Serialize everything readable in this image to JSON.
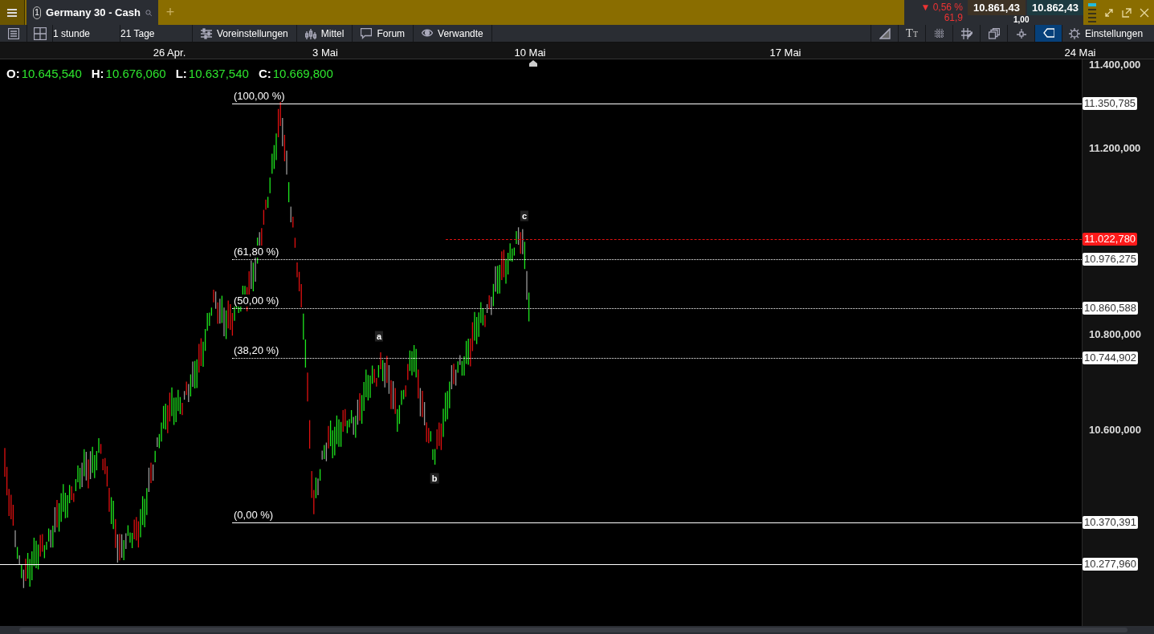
{
  "top_bar": {
    "tab": {
      "number": "1",
      "title": "Germany 30 - Cash"
    },
    "add_tab": "+",
    "quote": {
      "change": "▼ 0,56 %",
      "points": "61,9",
      "bid": "10.861,43",
      "ask": "10.862,43",
      "spread": "1,00"
    }
  },
  "toolbar": {
    "interval": "1 stunde",
    "range": "21 Tage",
    "buttons": [
      {
        "label": "Voreinstellungen",
        "kind": "sliders"
      },
      {
        "label": "Mittel",
        "kind": "candles"
      },
      {
        "label": "Forum",
        "kind": "comment"
      },
      {
        "label": "Verwandte",
        "kind": "eye"
      }
    ],
    "tools": [
      {
        "kind": "draw",
        "selected": false
      },
      {
        "kind": "text",
        "glyph": "TT",
        "selected": false
      },
      {
        "kind": "grid",
        "selected": false
      },
      {
        "kind": "pen",
        "selected": false
      },
      {
        "kind": "layers",
        "selected": false
      },
      {
        "kind": "cross",
        "selected": false
      },
      {
        "kind": "tag",
        "selected": true
      }
    ],
    "settings": "Einstellungen"
  },
  "chart": {
    "dates": [
      "26 Apr.",
      "3 Mai",
      "10 Mai",
      "17 Mai",
      "24 Mai"
    ],
    "ohlc": [
      {
        "key": "O:",
        "value": "10.645,540"
      },
      {
        "key": "H:",
        "value": "10.676,060"
      },
      {
        "key": "L:",
        "value": "10.637,540"
      },
      {
        "key": "C:",
        "value": "10.669,800"
      }
    ],
    "fib_levels": [
      "(100,00 %)",
      "(61,80 %)",
      "(50,00 %)",
      "(38,20 %)",
      "(0,00 %)"
    ],
    "wave_labels": [
      "a",
      "b",
      "c"
    ],
    "price_axis": [
      "11.400,000",
      "11.200,000",
      "10.800,000",
      "10.600,000"
    ],
    "price_tags": [
      {
        "value": "11.350,785",
        "kind": "level"
      },
      {
        "value": "11.022,780",
        "kind": "current"
      },
      {
        "value": "10.976,275",
        "kind": "level"
      },
      {
        "value": "10.860,588",
        "kind": "level"
      },
      {
        "value": "10.744,902",
        "kind": "level"
      },
      {
        "value": "10.370,391",
        "kind": "level"
      },
      {
        "value": "10.277,960",
        "kind": "level"
      }
    ]
  }
}
